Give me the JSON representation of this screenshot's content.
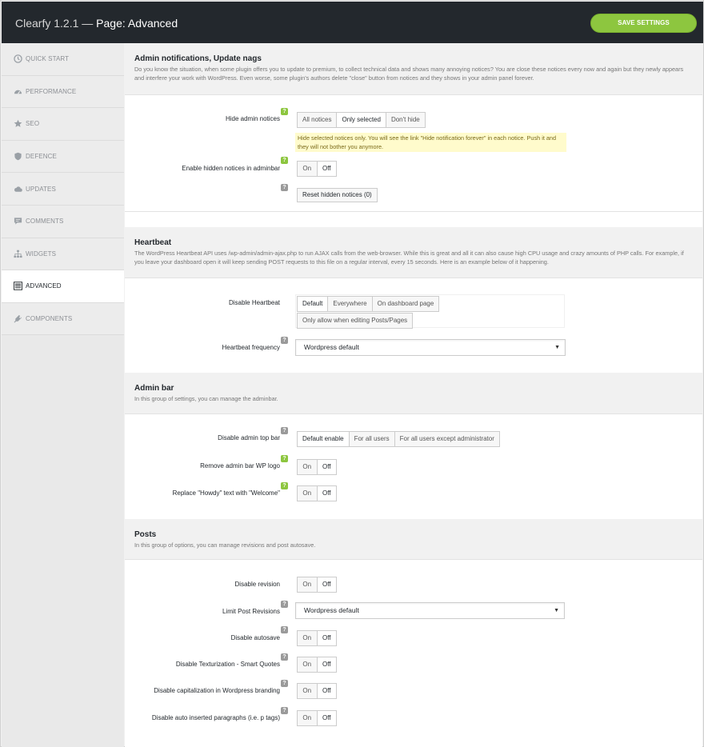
{
  "header": {
    "brand": "Clearfy 1.2.1 —",
    "page": "Page: Advanced",
    "save_label": "SAVE SETTINGS",
    "accent": "#8dc63f"
  },
  "sidebar": {
    "items": [
      {
        "label": "Quick start",
        "icon": "clock-icon"
      },
      {
        "label": "Performance",
        "icon": "dashboard-icon"
      },
      {
        "label": "SEO",
        "icon": "star-icon"
      },
      {
        "label": "Defence",
        "icon": "shield-icon"
      },
      {
        "label": "Updates",
        "icon": "cloud-icon"
      },
      {
        "label": "Comments",
        "icon": "comment-icon"
      },
      {
        "label": "Widgets",
        "icon": "sitemap-icon"
      },
      {
        "label": "Advanced",
        "icon": "list-icon",
        "active": true
      },
      {
        "label": "Components",
        "icon": "plugin-icon"
      }
    ]
  },
  "sections": {
    "notices": {
      "title": "Admin notifications, Update nags",
      "desc": "Do you know the situation, when some plugin offers you to update to premium, to collect technical data and shows many annoying notices? You are close these notices every now and again but they newly appears and interfere your work with WordPress. Even worse, some plugin's authors delete \"close\" button from notices and they shows in your admin panel forever.",
      "hide_label": "Hide admin notices",
      "hide_options": [
        "All notices",
        "Only selected",
        "Don't hide"
      ],
      "hide_selected": "Only selected",
      "hide_hint": "Hide selected notices only. You will see the link \"Hide notification forever\" in each notice. Push it and they will not bother you anymore.",
      "adminbar_label": "Enable hidden notices in adminbar",
      "reset_label": "Reset hidden notices (0)"
    },
    "heartbeat": {
      "title": "Heartbeat",
      "desc": "The WordPress Heartbeat API uses /wp-admin/admin-ajax.php to run AJAX calls from the web-browser. While this is great and all it can also cause high CPU usage and crazy amounts of PHP calls. For example, if you leave your dashboard open it will keep sending POST requests to this file on a regular interval, every 15 seconds. Here is an example below of it happening.",
      "disable_label": "Disable Heartbeat",
      "disable_options": [
        "Default",
        "Everywhere",
        "On dashboard page"
      ],
      "disable_option_extra": "Only allow when editing Posts/Pages",
      "frequency_label": "Heartbeat frequency",
      "frequency_value": "Wordpress default"
    },
    "adminbar": {
      "title": "Admin bar",
      "desc": "In this group of settings, you can manage the adminbar.",
      "top_label": "Disable admin top bar",
      "top_options": [
        "Default enable",
        "For all users",
        "For all users except administrator"
      ],
      "logo_label": "Remove admin bar WP logo",
      "howdy_label": "Replace \"Howdy\" text with \"Welcome\""
    },
    "posts": {
      "title": "Posts",
      "desc": "In this group of options, you can manage revisions and post autosave.",
      "revision_label": "Disable revision",
      "limit_label": "Limit Post Revisions",
      "limit_value": "Wordpress default",
      "autosave_label": "Disable autosave",
      "texturize_label": "Disable Texturization - Smart Quotes",
      "capital_label": "Disable capitalization in Wordpress branding",
      "autop_label": "Disable auto inserted paragraphs (i.e. p tags)"
    }
  },
  "toggle": {
    "on": "On",
    "off": "Off"
  },
  "help_mark": "?"
}
